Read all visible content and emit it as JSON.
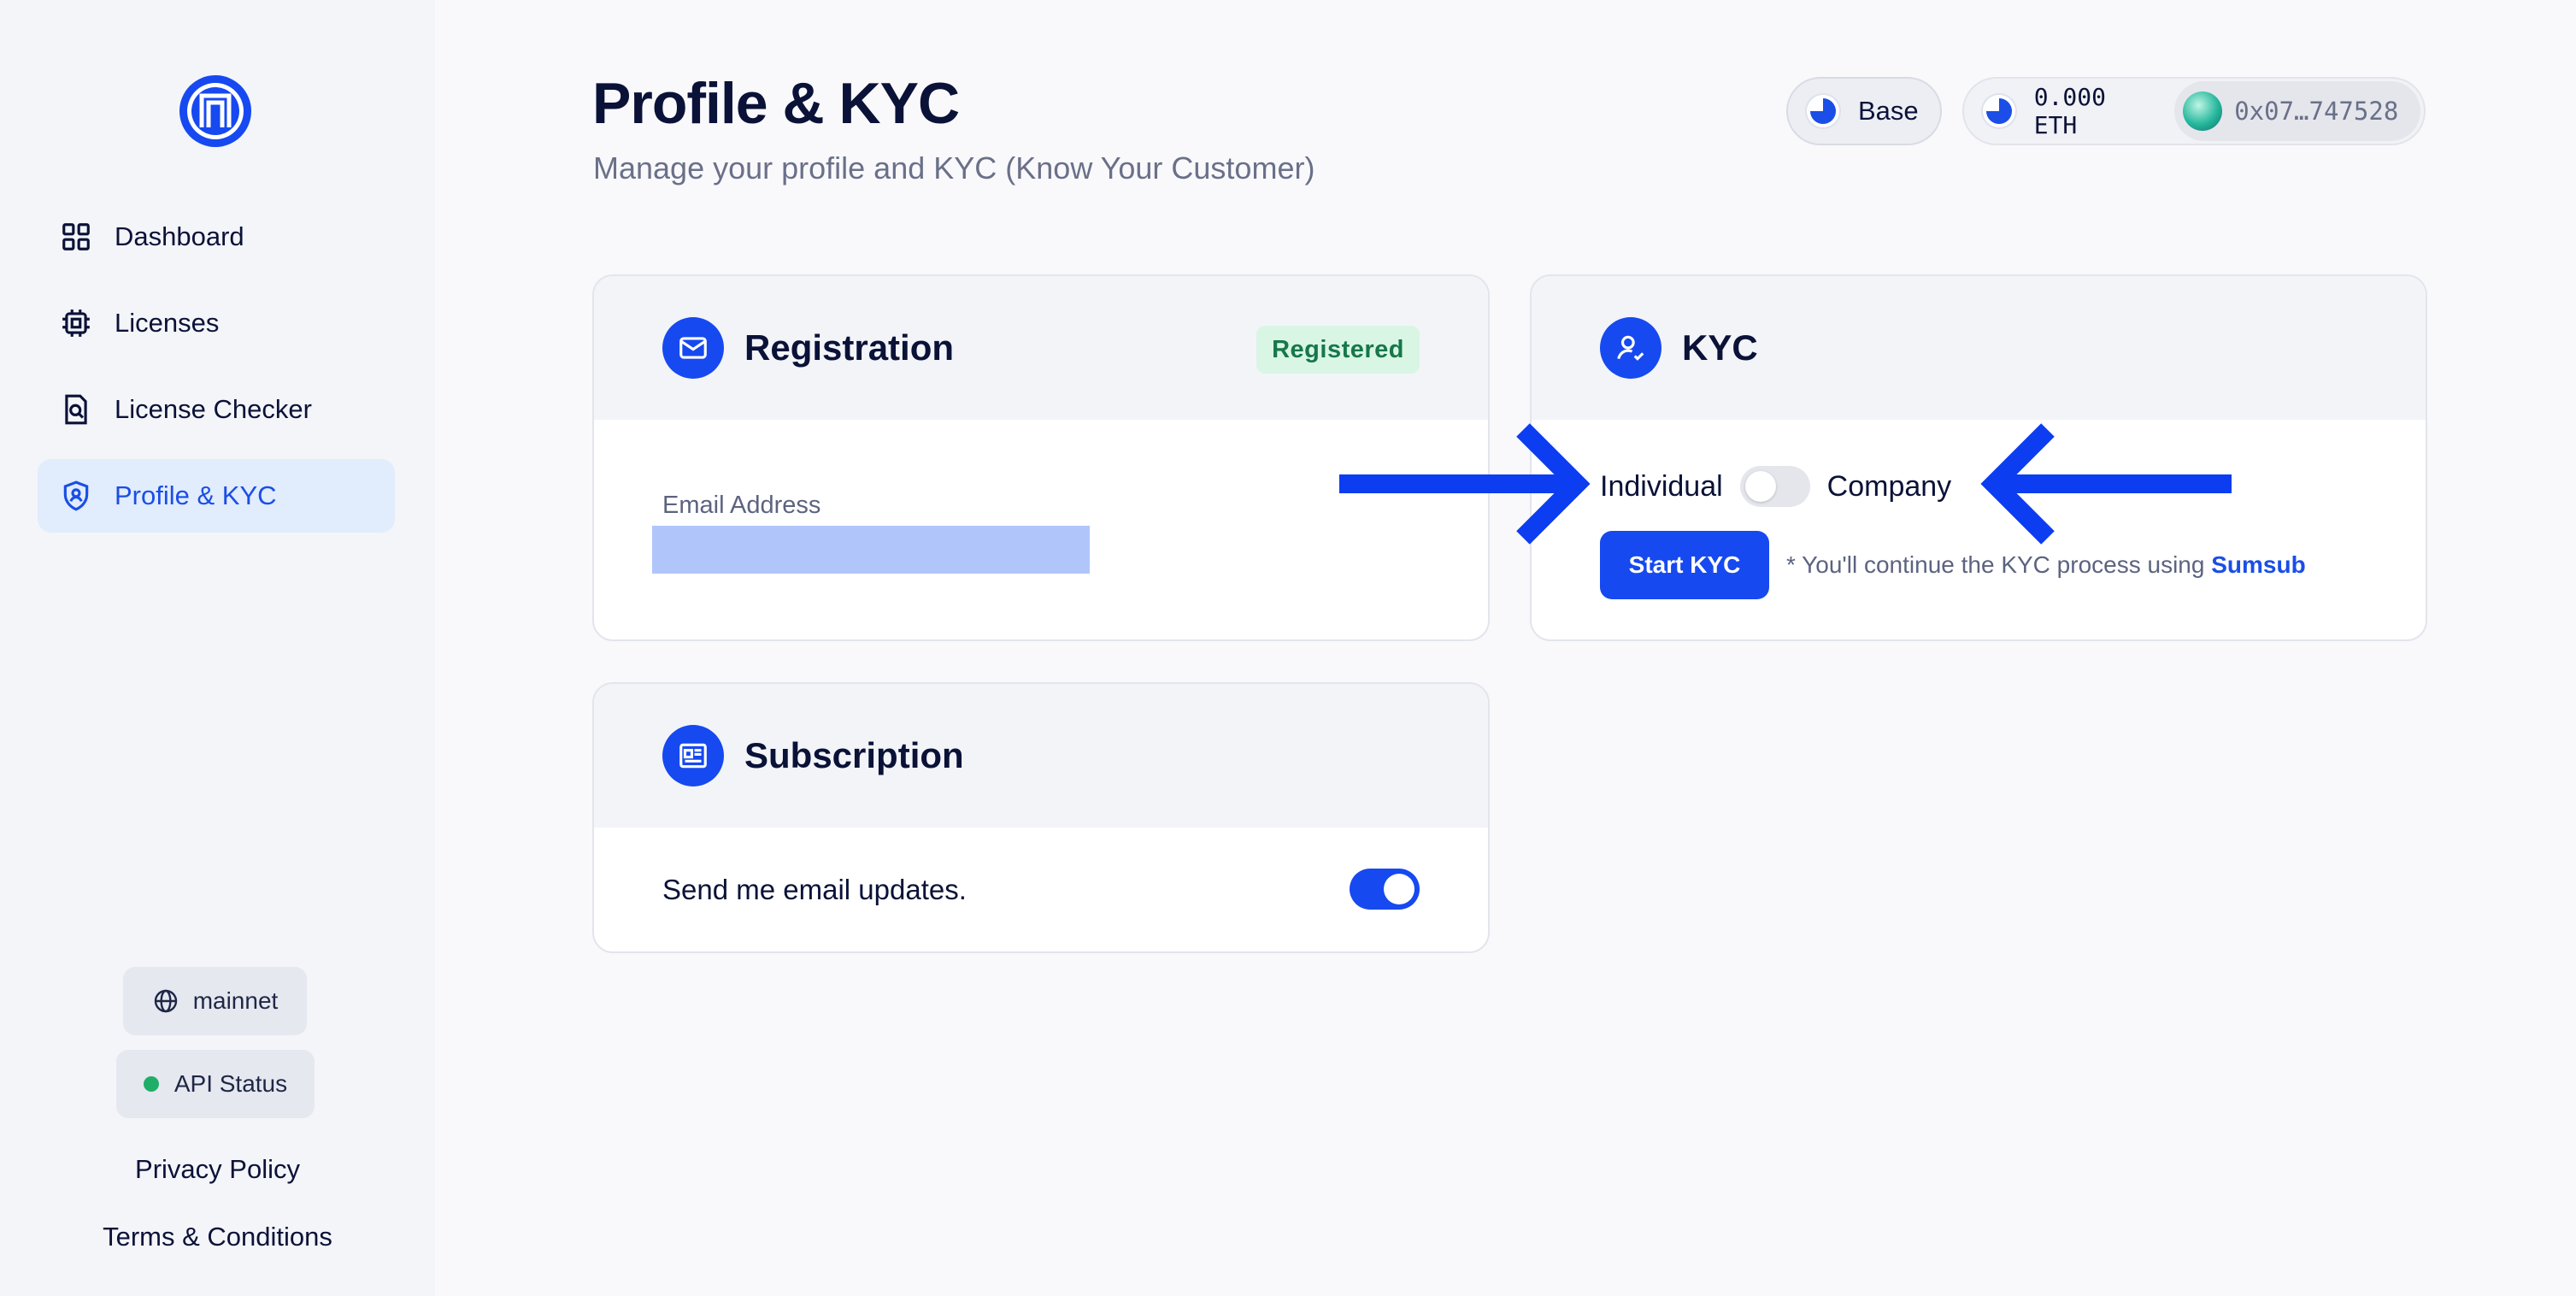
{
  "sidebar": {
    "logo": "app-logo",
    "items": [
      {
        "label": "Dashboard",
        "icon": "dashboard-grid-icon"
      },
      {
        "label": "Licenses",
        "icon": "chip-icon"
      },
      {
        "label": "License Checker",
        "icon": "document-search-icon"
      },
      {
        "label": "Profile & KYC",
        "icon": "user-shield-icon",
        "active": true
      }
    ],
    "network": {
      "label": "mainnet",
      "icon": "globe-icon"
    },
    "api_status": {
      "label": "API Status",
      "status_color": "#1fae68"
    },
    "links": {
      "privacy": "Privacy Policy",
      "terms": "Terms & Conditions"
    }
  },
  "header": {
    "title": "Profile & KYC",
    "subtitle": "Manage your profile and KYC (Know Your Customer)",
    "chain": {
      "label": "Base",
      "icon": "base-chain-icon"
    },
    "wallet": {
      "balance": "0.000 ETH",
      "address": "0x07…747528",
      "icon": "avatar-icon"
    }
  },
  "registration": {
    "title": "Registration",
    "badge": "Registered",
    "email_label": "Email Address",
    "email_value": ""
  },
  "kyc": {
    "title": "KYC",
    "option_left": "Individual",
    "option_right": "Company",
    "toggle_on": false,
    "button": "Start KYC",
    "note_prefix": "* You'll continue the KYC process using ",
    "note_link": "Sumsub"
  },
  "subscription": {
    "title": "Subscription",
    "text": "Send me email updates.",
    "toggle_on": true
  },
  "colors": {
    "accent": "#1649f0",
    "active_nav_bg": "#e1ecfc",
    "badge_green_bg": "#d9f6e5",
    "badge_green_text": "#17774a",
    "annotation_arrow": "#0d3df0"
  }
}
